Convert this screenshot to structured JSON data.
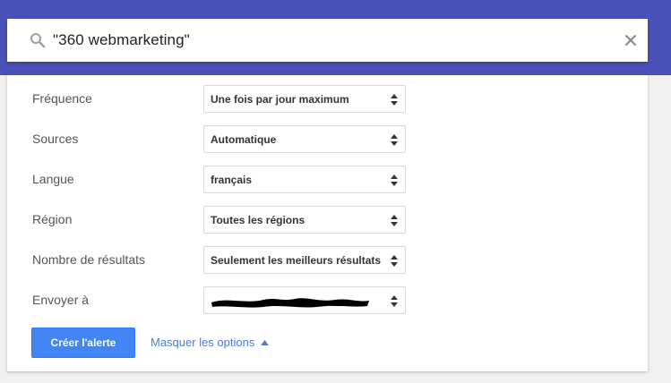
{
  "search": {
    "query": "\"360 webmarketing\"",
    "icon": "search-icon",
    "clear_icon": "close-icon"
  },
  "options": [
    {
      "label": "Fréquence",
      "value": "Une fois par jour maximum"
    },
    {
      "label": "Sources",
      "value": "Automatique"
    },
    {
      "label": "Langue",
      "value": "français"
    },
    {
      "label": "Région",
      "value": "Toutes les régions"
    },
    {
      "label": "Nombre de résultats",
      "value": "Seulement les meilleurs résultats"
    },
    {
      "label": "Envoyer à",
      "value": ""
    }
  ],
  "actions": {
    "create_label": "Créer l'alerte",
    "hide_options_label": "Masquer les options"
  },
  "colors": {
    "header": "#4a52b9",
    "primary_button": "#4285f4",
    "link": "#4b7be0"
  }
}
